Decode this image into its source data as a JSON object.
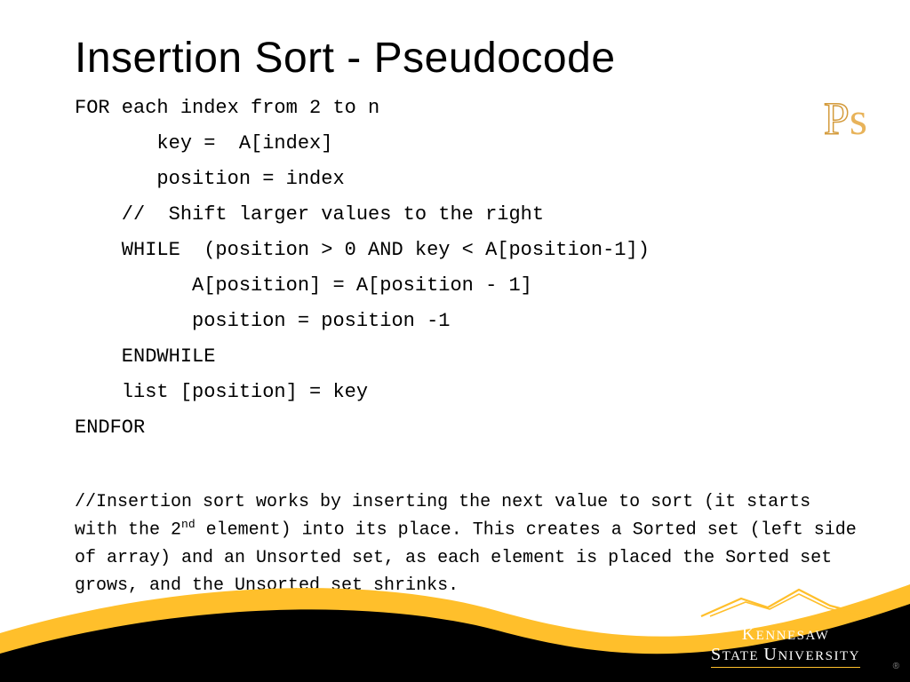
{
  "title": "Insertion Sort - Pseudocode",
  "badge": {
    "p": "P",
    "s": "s"
  },
  "code": {
    "l1": "FOR each index from 2 to n",
    "l2": "       key =  A[index]",
    "l3": "       position = index",
    "l4": "    //  Shift larger values to the right",
    "l5": "    WHILE  (position > 0 AND key < A[position-1])",
    "l6": "          A[position] = A[position - 1]",
    "l7": "          position = position -1",
    "l8": "    ENDWHILE",
    "l9": "    list [position] = key",
    "l10": "ENDFOR"
  },
  "desc": {
    "part1": "//Insertion sort works by inserting the next value to sort (it starts with the 2",
    "sup": "nd",
    "part2": " element) into its place. This creates a Sorted set (left side of array) and an Unsorted set, as each element is placed the Sorted set grows, and the Unsorted set shrinks."
  },
  "logo": {
    "line1a": "K",
    "line1b": "ENNESAW",
    "line2a": "S",
    "line2b": "TATE ",
    "line2c": "U",
    "line2d": "NIVERSITY"
  },
  "colors": {
    "gold": "#ffbf2b",
    "black": "#000000"
  }
}
